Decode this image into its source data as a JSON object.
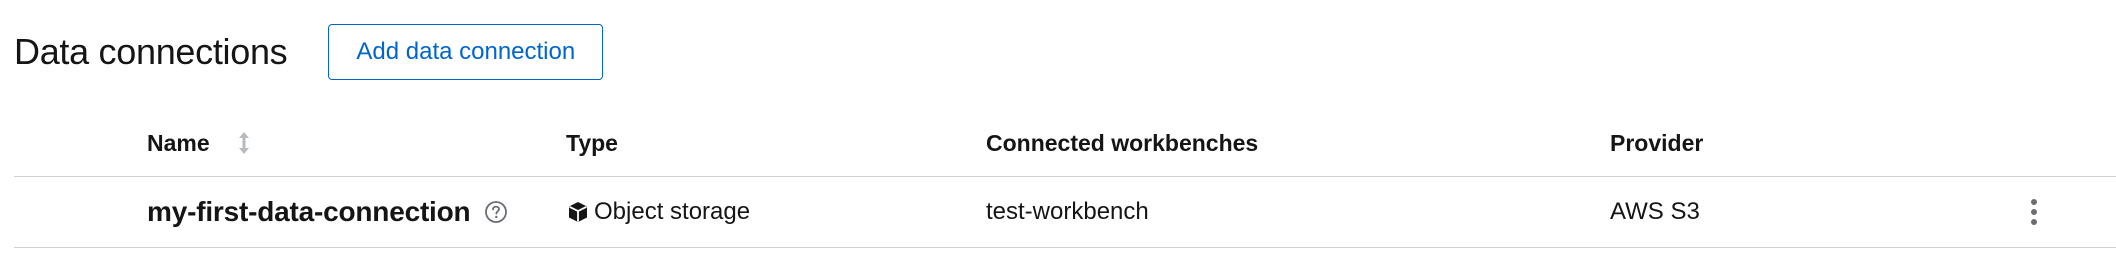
{
  "header": {
    "title": "Data connections",
    "add_button_label": "Add data connection"
  },
  "table": {
    "columns": [
      "Name",
      "Type",
      "Connected workbenches",
      "Provider"
    ],
    "rows": [
      {
        "name": "my-first-data-connection",
        "type": "Object storage",
        "connected_workbenches": "test-workbench",
        "provider": "AWS S3"
      }
    ]
  },
  "icons": {
    "sort": "sort-icon",
    "help": "help-icon",
    "type": "cube-icon",
    "actions": "kebab-icon"
  },
  "colors": {
    "accent": "#0066cc",
    "text": "#151515",
    "muted_icon": "#6a6e73",
    "sort_icon": "#b8bbbe",
    "divider": "#d2d2d2"
  }
}
